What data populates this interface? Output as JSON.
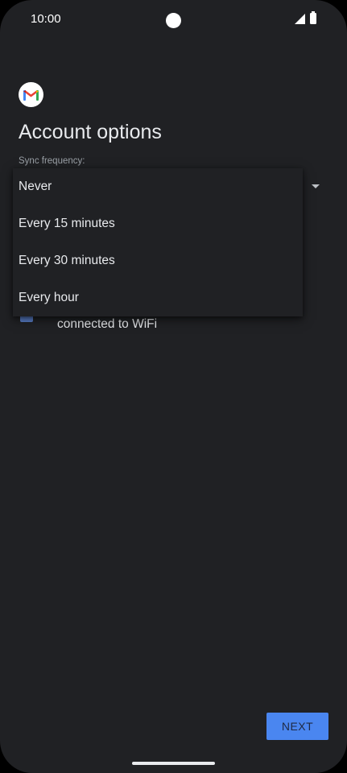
{
  "status_bar": {
    "time": "10:00"
  },
  "header": {
    "title": "Account options"
  },
  "sync": {
    "label": "Sync frequency:",
    "options": [
      "Never",
      "Every 15 minutes",
      "Every 30 minutes",
      "Every hour"
    ]
  },
  "wifi_checkbox": {
    "label_visible": "connected to WiFi",
    "checked": true
  },
  "footer": {
    "next_label": "NEXT"
  },
  "colors": {
    "background": "#202124",
    "accent": "#4a86f0"
  }
}
